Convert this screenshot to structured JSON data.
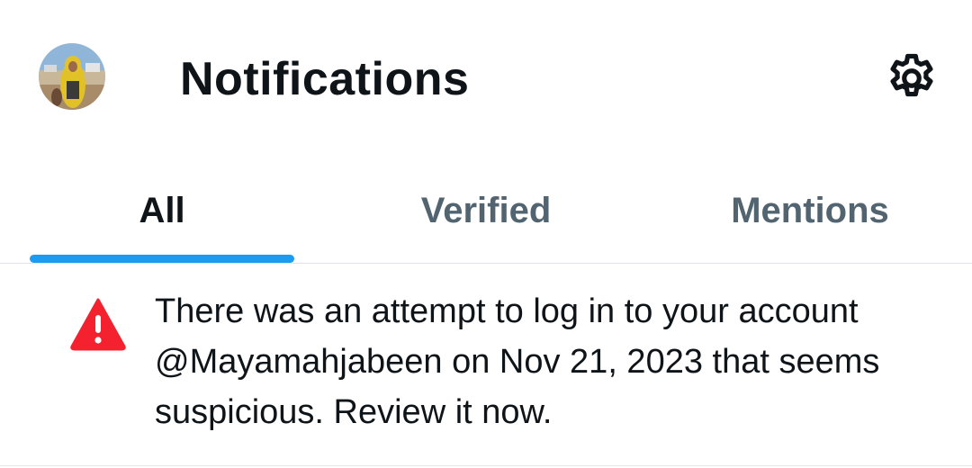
{
  "header": {
    "title": "Notifications",
    "avatar_icon": "user-avatar",
    "settings_icon": "gear-icon"
  },
  "tabs": [
    {
      "label": "All",
      "active": true
    },
    {
      "label": "Verified",
      "active": false
    },
    {
      "label": "Mentions",
      "active": false
    }
  ],
  "notification": {
    "icon": "warning-icon",
    "icon_color": "#f4212e",
    "text": "There was an attempt to log in to your account @Mayamahjabeen on Nov 21, 2023 that seems suspicious. Review it now."
  },
  "colors": {
    "accent": "#1d9bf0",
    "primary_text": "#0f1419",
    "secondary_text": "#536471"
  }
}
